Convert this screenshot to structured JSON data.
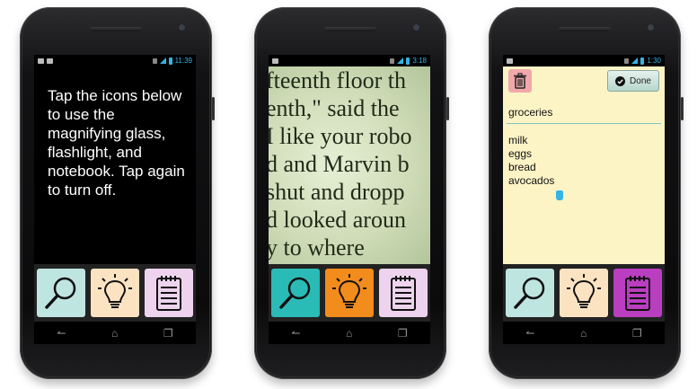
{
  "phones": [
    {
      "status": {
        "time": "11:39"
      },
      "instructions": "Tap the icons below to use the magnifying glass, flashlight, and notebook. Tap again to turn off.",
      "tools": [
        {
          "icon": "magnifying-glass-icon",
          "bg": "#bfe5e1"
        },
        {
          "icon": "light-bulb-icon",
          "bg": "#fbe3c2"
        },
        {
          "icon": "notepad-icon",
          "bg": "#edd3ee"
        }
      ]
    },
    {
      "status": {
        "time": "3:18"
      },
      "book_lines": [
        "fteenth floor th",
        "enth,\" said the",
        "I like your robo",
        "d and Marvin b",
        "shut and dropp",
        "d looked aroun",
        "y to where"
      ],
      "tools": [
        {
          "icon": "magnifying-glass-icon",
          "bg": "#2bbbb6"
        },
        {
          "icon": "light-bulb-icon",
          "bg": "#f28c1c"
        },
        {
          "icon": "notepad-icon",
          "bg": "#edd3ee"
        }
      ]
    },
    {
      "status": {
        "time": "1:30"
      },
      "note": {
        "done_label": "Done",
        "title": "groceries",
        "items": [
          "milk",
          "eggs",
          "bread",
          "avocados"
        ]
      },
      "tools": [
        {
          "icon": "magnifying-glass-icon",
          "bg": "#bfe5e1"
        },
        {
          "icon": "light-bulb-icon",
          "bg": "#fbe3c2"
        },
        {
          "icon": "notepad-icon",
          "bg": "#b93ec0"
        }
      ]
    }
  ],
  "colors": {
    "accent": "#33b5e5",
    "phone_body": "#121214"
  }
}
